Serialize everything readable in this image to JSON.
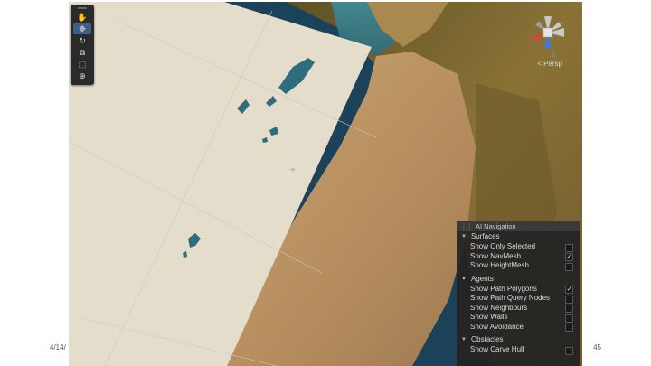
{
  "slide": {
    "date": "4/14/",
    "page_number": "45"
  },
  "toolbar": {
    "tools": [
      {
        "icon": "hand-icon",
        "glyph": "✋",
        "active": false
      },
      {
        "icon": "move-icon",
        "glyph": "✥",
        "active": true
      },
      {
        "icon": "rotate-icon",
        "glyph": "↻",
        "active": false
      },
      {
        "icon": "scale-icon",
        "glyph": "⧉",
        "active": false
      },
      {
        "icon": "rect-icon",
        "glyph": "⬚",
        "active": false
      },
      {
        "icon": "transform-icon",
        "glyph": "⊕",
        "active": false
      }
    ]
  },
  "gizmo": {
    "x_label": "x",
    "z_label": "z",
    "projection": "< Persp"
  },
  "ai_navigation": {
    "title": "AI Navigation",
    "surfaces": {
      "header": "Surfaces",
      "show_only_selected": {
        "label": "Show Only Selected",
        "checked": false
      },
      "show_navmesh": {
        "label": "Show NavMesh",
        "checked": true
      },
      "show_heightmesh": {
        "label": "Show HeightMesh",
        "checked": false
      }
    },
    "agents": {
      "header": "Agents",
      "show_path_polygons": {
        "label": "Show Path Polygons",
        "checked": true
      },
      "show_path_query_nodes": {
        "label": "Show Path Query Nodes",
        "checked": false
      },
      "show_neighbours": {
        "label": "Show Neighbours",
        "checked": false
      },
      "show_walls": {
        "label": "Show Walls",
        "checked": false
      },
      "show_avoidance": {
        "label": "Show Avoidance",
        "checked": false
      }
    },
    "obstacles": {
      "header": "Obstacles",
      "show_carve_hull": {
        "label": "Show Carve Hull",
        "checked": false
      }
    }
  },
  "colors": {
    "water": "#1e4860",
    "navmesh": "#e4ddcc",
    "sand": "#c09a6a",
    "terrain": "#7a6530",
    "panel_bg": "#222222",
    "active_tool": "#3d5f8a"
  }
}
